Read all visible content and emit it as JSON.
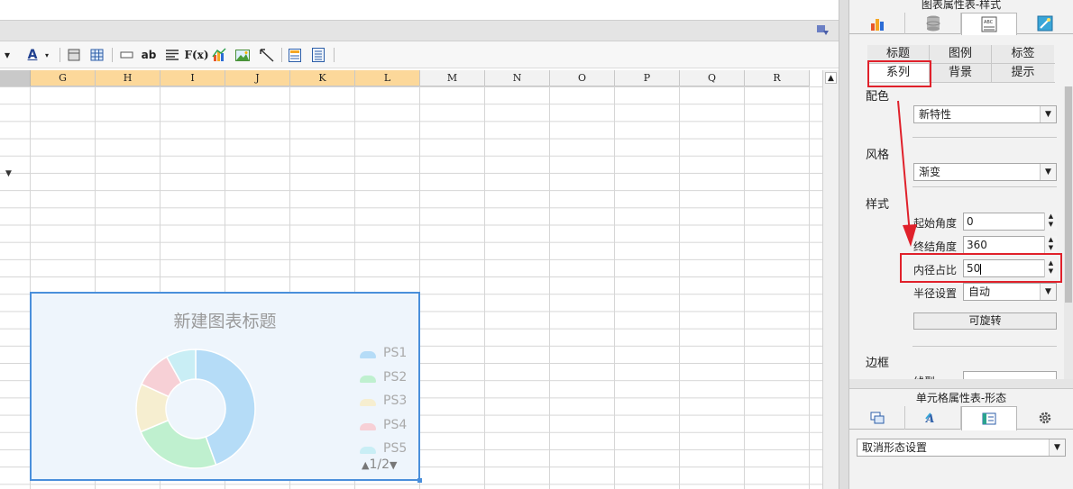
{
  "sheet": {
    "columns": [
      "G",
      "H",
      "I",
      "J",
      "K",
      "L",
      "M",
      "N",
      "O",
      "P",
      "Q",
      "R"
    ],
    "selected_columns": [
      "G",
      "H",
      "I",
      "J",
      "K",
      "L"
    ]
  },
  "toolbar": {
    "font_color_glyph": "A",
    "ab_glyph": "ab",
    "fx_glyph": "F(x)"
  },
  "chart": {
    "title": "新建图表标题",
    "pager": "1/2"
  },
  "chart_data": {
    "type": "pie",
    "donut": true,
    "title": "新建图表标题",
    "categories": [
      "PS1",
      "PS2",
      "PS3",
      "PS4",
      "PS5"
    ],
    "values": [
      44,
      24,
      13,
      10,
      8
    ],
    "colors": [
      "#b5dcf7",
      "#bff0cf",
      "#f6eed0",
      "#f7d0d6",
      "#c9eef5"
    ],
    "legend": "right"
  },
  "right_panel": {
    "title": "图表属性表-样式",
    "subtabs_row1": [
      "标题",
      "图例",
      "标签"
    ],
    "subtabs_row2": [
      "系列",
      "背景",
      "提示"
    ],
    "section_color": "配色",
    "color_value": "新特性",
    "section_style_type": "风格",
    "style_type_value": "渐变",
    "section_style": "样式",
    "start_angle_label": "起始角度",
    "start_angle_value": "0",
    "end_angle_label": "终结角度",
    "end_angle_value": "360",
    "inner_ratio_label": "内径占比",
    "inner_ratio_value": "50",
    "radius_label": "半径设置",
    "radius_value": "自动",
    "rotate_button": "可旋转",
    "section_border": "边框",
    "border_partial_label": "线型",
    "bottom_title": "单元格属性表-形态",
    "bottom_select_value": "取消形态设置"
  },
  "colors": {
    "selection_header": "#fcd89a",
    "chart_border": "#4a8fdb",
    "annotation_red": "#e0212b"
  }
}
